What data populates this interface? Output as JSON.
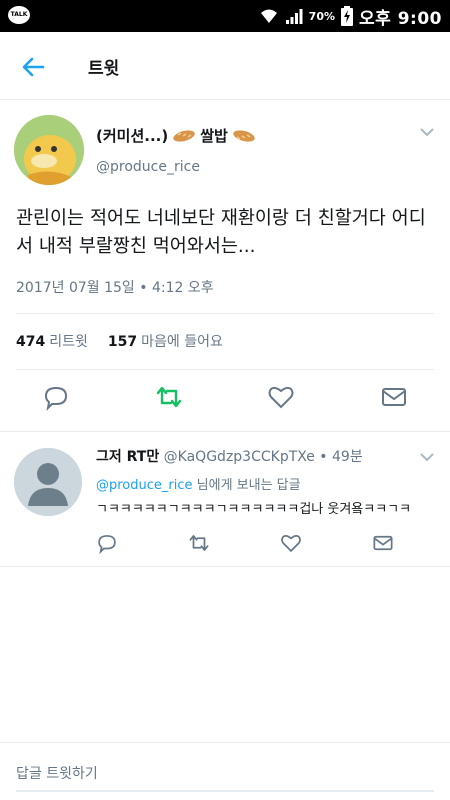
{
  "status_bar": {
    "talk_label": "TALK",
    "battery_pct": "70%",
    "time": "오후 9:00"
  },
  "header": {
    "title": "트윗"
  },
  "tweet": {
    "author_name": "(커미션...) ",
    "author_name_suffix": "쌀밥",
    "handle": "@produce_rice",
    "text": "관린이는 적어도 너네보단 재환이랑 더 친할거다 어디서 내적 부랄짱친 먹어와서는...",
    "timestamp": "2017년 07월 15일 • 4:12 오후",
    "retweets_count": "474",
    "retweets_label": "리트윗",
    "likes_count": "157",
    "likes_label": "마음에 들어요"
  },
  "reply": {
    "name": "그저 RT만",
    "handle": "@KaQGdzp3CCKpTXe",
    "dot": "•",
    "age": "49분",
    "to_mention": "@produce_rice",
    "to_suffix": " 님에게 보내는 답글",
    "text": "ㄱㅋㅋㅋㅋㅋㄱㅋㅋㅋㄱㅋㅋㅋㅋㅋㅋ겁나 웃겨욬ㅋㅋㄱㅋ"
  },
  "composer": {
    "placeholder": "답글 트윗하기"
  },
  "colors": {
    "accent": "#1da1f2",
    "retweet_green": "#17bf63",
    "muted": "#657786"
  }
}
